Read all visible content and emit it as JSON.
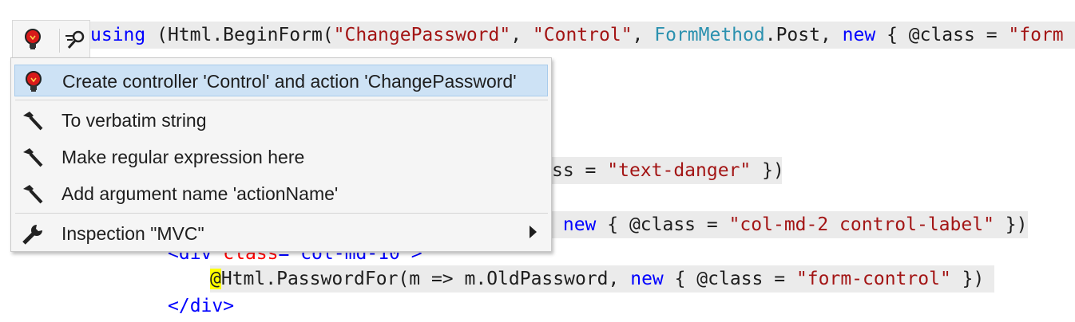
{
  "code": {
    "line1": {
      "using": "using",
      "part1": " (Html.BeginForm(",
      "s1": "\"ChangePassword\"",
      "comma1": ", ",
      "s2": "\"Control\"",
      "comma2": ", ",
      "type": "FormMethod",
      "post": ".Post, ",
      "new": "new",
      "rest": " { @class = ",
      "s3": "\"form"
    },
    "line_danger": {
      "pre": "ss = ",
      "str": "\"text-danger\"",
      "post": " })"
    },
    "line_label": {
      "new": "new",
      "mid": " { @class = ",
      "str": "\"col-md-2 control-label\"",
      "post": " })"
    },
    "line_div_open": {
      "open": "<div ",
      "attr": "class",
      "eq": "=",
      "val": "\"col-md-10\"",
      "close": ">"
    },
    "line_password": {
      "at": "@",
      "pre": "Html.PasswordFor(m => m.OldPassword, ",
      "new": "new",
      "mid": " { @class = ",
      "str": "\"form-control\"",
      "post": " })"
    },
    "line_div_close": "</div>"
  },
  "bulb_tab": {
    "bulb_icon": "lightbulb-icon",
    "inspect_icon": "inspect-icon"
  },
  "menu": {
    "items": [
      {
        "label": "Create controller 'Control' and action 'ChangePassword'",
        "icon": "lightbulb-icon"
      },
      {
        "label": "To verbatim string",
        "icon": "hammer-icon"
      },
      {
        "label": "Make regular expression here",
        "icon": "hammer-icon"
      },
      {
        "label": "Add argument name 'actionName'",
        "icon": "hammer-icon"
      },
      {
        "label": "Inspection \"MVC\"",
        "icon": "wrench-icon"
      }
    ]
  },
  "colors": {
    "keyword": "#0000ff",
    "string": "#a31515",
    "type": "#2b91af",
    "selection": "#cde2f5"
  }
}
